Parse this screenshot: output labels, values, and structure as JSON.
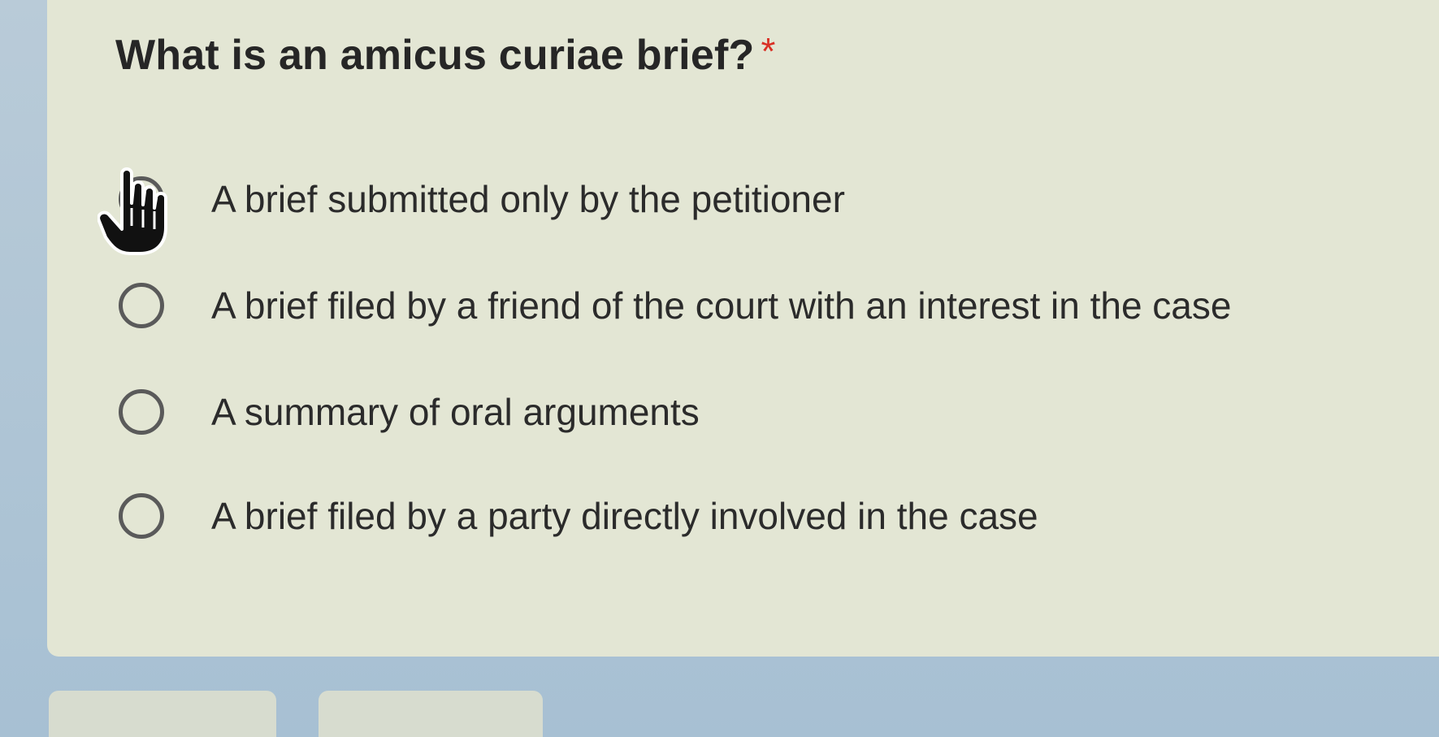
{
  "question": {
    "text": "What is an amicus curiae brief?",
    "required_marker": "*"
  },
  "options": [
    {
      "label": "A brief submitted only by the petitioner",
      "selected": false
    },
    {
      "label": "A brief filed by a friend of the court with an interest in the case",
      "selected": false
    },
    {
      "label": "A summary of oral arguments",
      "selected": false
    },
    {
      "label": "A brief filed by a party directly involved in the case",
      "selected": false
    }
  ],
  "cursor": {
    "icon": "hand-pointer-icon"
  },
  "buttons": {
    "back_label": "",
    "next_label": ""
  },
  "colors": {
    "card_background": "#e3e6d4",
    "page_background": "#a9c3d6",
    "required_star": "#d93025",
    "radio_border": "#5a5a5a"
  }
}
